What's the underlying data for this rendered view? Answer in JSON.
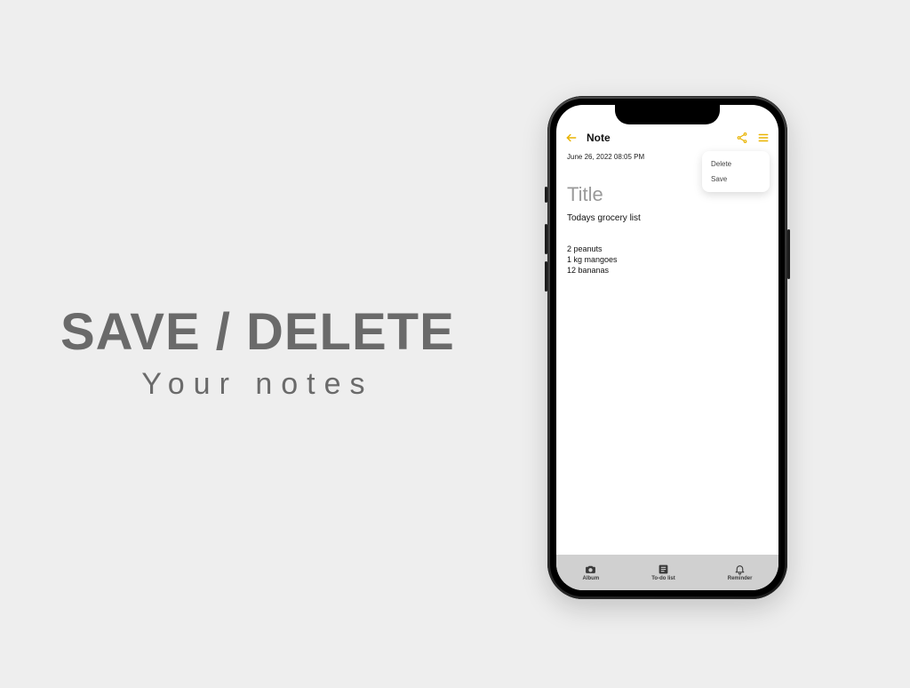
{
  "promo": {
    "heading": "SAVE / DELETE",
    "subheading": "Your notes"
  },
  "app": {
    "header_title": "Note",
    "timestamp": "June 26, 2022 08:05 PM",
    "dropdown": {
      "delete": "Delete",
      "save": "Save"
    },
    "note": {
      "title_placeholder": "Title",
      "subject": "Todays grocery list",
      "body": "2 peanuts\n1 kg mangoes\n12 bananas"
    },
    "nav": {
      "album": "Album",
      "todo": "To-do list",
      "reminder": "Reminder"
    }
  }
}
